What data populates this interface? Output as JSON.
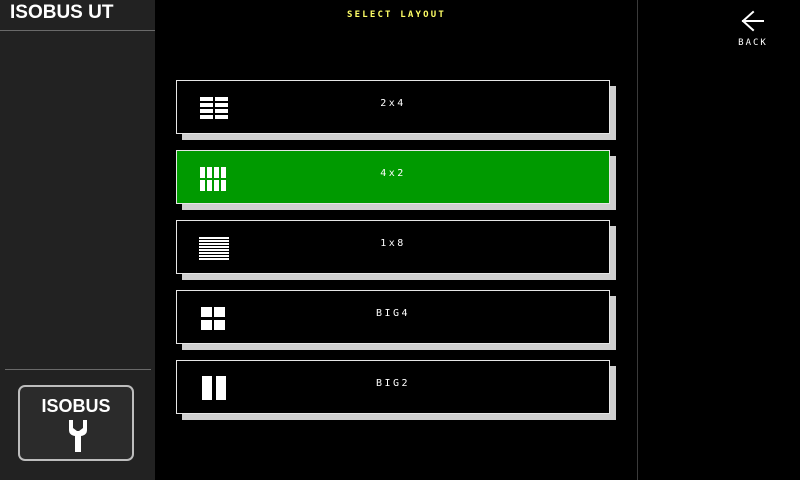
{
  "app": {
    "title": "ISOBUS UT"
  },
  "header": {
    "title": "SELECT LAYOUT"
  },
  "back": {
    "label": "BACK",
    "icon": "arrow-left-icon"
  },
  "sidebar": {
    "isobus_button": {
      "label": "ISOBUS",
      "icon": "wrench-icon"
    }
  },
  "colors": {
    "selected_background": "#009a00",
    "title_text": "#ffff66",
    "sidebar_background": "#222222"
  },
  "layouts": [
    {
      "label": "2x4",
      "icon": "grid-2x4-icon",
      "selected": false
    },
    {
      "label": "4x2",
      "icon": "grid-4x2-icon",
      "selected": true
    },
    {
      "label": "1x8",
      "icon": "list-1x8-icon",
      "selected": false
    },
    {
      "label": "BIG4",
      "icon": "grid-big4-icon",
      "selected": false
    },
    {
      "label": "BIG2",
      "icon": "grid-big2-icon",
      "selected": false
    }
  ]
}
